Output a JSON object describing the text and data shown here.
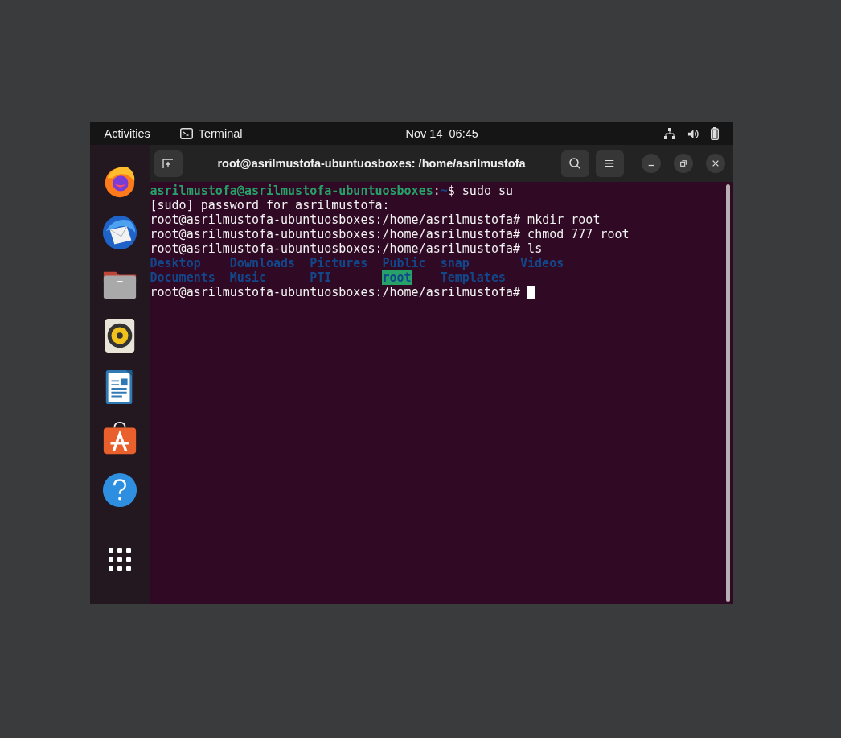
{
  "top_bar": {
    "activities": "Activities",
    "app_name": "Terminal",
    "clock": "Nov 14  06:45"
  },
  "window": {
    "title": "root@asrilmustofa-ubuntuosboxes: /home/asrilmustofa"
  },
  "terminal": {
    "lines": [
      {
        "kind": "user_prompt",
        "user": "asrilmustofa@asrilmustofa-ubuntuosboxes",
        "separator": ":",
        "path": "~",
        "command": "$ sudo su"
      },
      {
        "kind": "text",
        "text": "[sudo] password for asrilmustofa:"
      },
      {
        "kind": "text",
        "text": "root@asrilmustofa-ubuntuosboxes:/home/asrilmustofa# mkdir root"
      },
      {
        "kind": "text",
        "text": "root@asrilmustofa-ubuntuosboxes:/home/asrilmustofa# chmod 777 root"
      },
      {
        "kind": "text",
        "text": "root@asrilmustofa-ubuntuosboxes:/home/asrilmustofa# ls"
      },
      {
        "kind": "listing",
        "columns": [
          [
            {
              "name": "Desktop",
              "highlighted": false
            },
            {
              "name": "Documents",
              "highlighted": false
            }
          ],
          [
            {
              "name": "Downloads",
              "highlighted": false
            },
            {
              "name": "Music",
              "highlighted": false
            }
          ],
          [
            {
              "name": "Pictures",
              "highlighted": false
            },
            {
              "name": "PTI",
              "highlighted": false
            }
          ],
          [
            {
              "name": "Public",
              "highlighted": false
            },
            {
              "name": "root",
              "highlighted": true
            }
          ],
          [
            {
              "name": "snap",
              "highlighted": false
            },
            {
              "name": "Templates",
              "highlighted": false
            }
          ],
          [
            {
              "name": "Videos",
              "highlighted": false
            }
          ]
        ]
      },
      {
        "kind": "text",
        "text": "root@asrilmustofa-ubuntuosboxes:/home/asrilmustofa# ",
        "cursor": true
      }
    ]
  }
}
